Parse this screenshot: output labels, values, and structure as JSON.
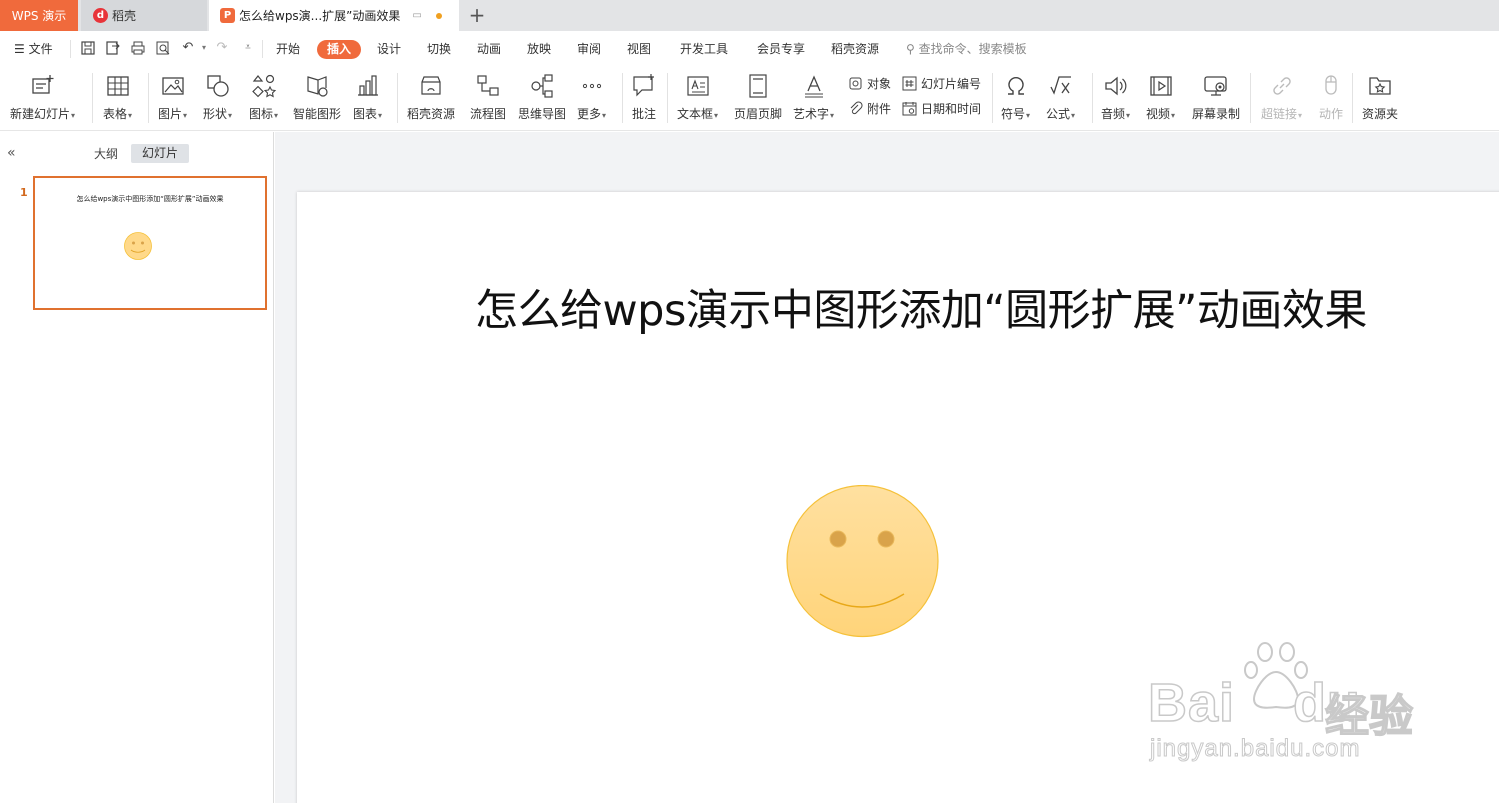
{
  "tabs": {
    "app": "WPS 演示",
    "daoke": "稻壳",
    "document": "怎么给wps演...扩展”动画效果",
    "new_tab": "+"
  },
  "menu": {
    "file": "文件",
    "items": [
      "开始",
      "插入",
      "设计",
      "切换",
      "动画",
      "放映",
      "审阅",
      "视图",
      "开发工具",
      "会员专享",
      "稻壳资源"
    ],
    "active": "插入",
    "search_placeholder": "查找命令、搜索模板"
  },
  "ribbon": {
    "new_slide": "新建幻灯片",
    "table": "表格",
    "picture": "图片",
    "shape": "形状",
    "icon": "图标",
    "smart_art": "智能图形",
    "chart": "图表",
    "daoke_resources": "稻壳资源",
    "flowchart": "流程图",
    "mindmap": "思维导图",
    "more": "更多",
    "comment": "批注",
    "textbox": "文本框",
    "header_footer": "页眉页脚",
    "wordart": "艺术字",
    "object": "对象",
    "attachment": "附件",
    "slide_number": "幻灯片编号",
    "date_time": "日期和时间",
    "symbol": "符号",
    "formula": "公式",
    "audio": "音频",
    "video": "视频",
    "screen_record": "屏幕录制",
    "hyperlink": "超链接",
    "action": "动作",
    "resource_folder": "资源夹"
  },
  "panel": {
    "outline_tab": "大纲",
    "slides_tab": "幻灯片",
    "slide_index": "1",
    "thumb_title": "怎么给wps演示中图形添加“圆形扩展”动画效果"
  },
  "slide": {
    "title": "怎么给wps演示中图形添加“圆形扩展”动画效果"
  },
  "colors": {
    "accent": "#f06a3c",
    "smiley_fill": "#ffd98a",
    "smiley_stroke": "#f5c13a"
  },
  "watermark": {
    "brand": "Bai",
    "brand2": "du",
    "cn": "经验",
    "url": "jingyan.baidu.com"
  }
}
